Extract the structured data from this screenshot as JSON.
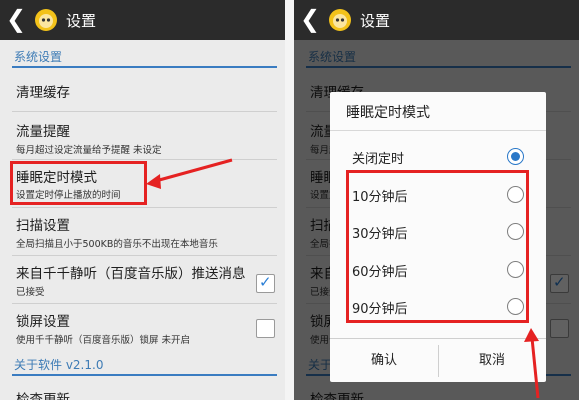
{
  "header": {
    "back_icon": "back-arrow-icon",
    "app_icon": "ttpod-mascot-icon",
    "title": "设置"
  },
  "settings": {
    "section_system": "系统设置",
    "items": [
      {
        "title": "清理缓存",
        "sub": ""
      },
      {
        "title": "流量提醒",
        "sub": "每月超过设定流量给予提醒 未设定"
      },
      {
        "title": "睡眠定时模式",
        "sub": "设置定时停止播放的时间"
      },
      {
        "title": "扫描设置",
        "sub": "全局扫描且小于500KB的音乐不出现在本地音乐"
      },
      {
        "title": "来自千千静听（百度音乐版）推送消息",
        "sub": "已接受",
        "checked": true
      },
      {
        "title": "锁屏设置",
        "sub": "使用千千静听（百度音乐版）锁屏 未开启",
        "checked": false
      }
    ],
    "section_about": "关于软件 v2.1.0",
    "partial_item": "检查更新"
  },
  "dialog": {
    "title": "睡眠定时模式",
    "options": [
      {
        "label": "关闭定时",
        "selected": true
      },
      {
        "label": "10分钟后",
        "selected": false
      },
      {
        "label": "30分钟后",
        "selected": false
      },
      {
        "label": "60分钟后",
        "selected": false
      },
      {
        "label": "90分钟后",
        "selected": false
      }
    ],
    "confirm": "确认",
    "cancel": "取消"
  },
  "colors": {
    "annotation_red": "#e52222",
    "accent_blue": "#3a7cc1",
    "header_bg": "#2b2b2b"
  }
}
